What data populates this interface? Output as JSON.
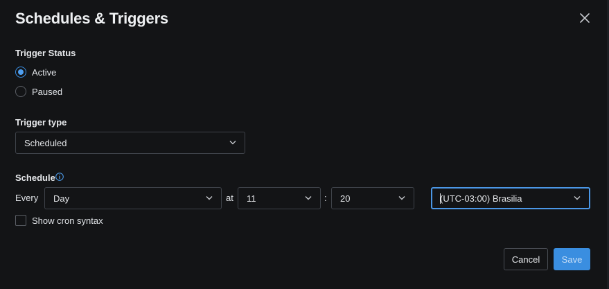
{
  "dialog": {
    "title": "Schedules & Triggers",
    "close_icon": "close-icon"
  },
  "trigger_status": {
    "label": "Trigger Status",
    "options": [
      {
        "label": "Active",
        "checked": true
      },
      {
        "label": "Paused",
        "checked": false
      }
    ]
  },
  "trigger_type": {
    "label": "Trigger type",
    "selected": "Scheduled"
  },
  "schedule": {
    "label": "Schedule",
    "info_icon": "info-icon",
    "every_label": "Every",
    "frequency": "Day",
    "at_label": "at",
    "hour": "11",
    "colon": ":",
    "minute": "20",
    "timezone": "(UTC-03:00) Brasilia",
    "cron_label": "Show cron syntax",
    "cron_checked": false
  },
  "footer": {
    "cancel_label": "Cancel",
    "save_label": "Save"
  },
  "colors": {
    "background": "#131416",
    "accent": "#3a8ee0",
    "border": "#3f434a",
    "text": "#e3e5e8"
  }
}
